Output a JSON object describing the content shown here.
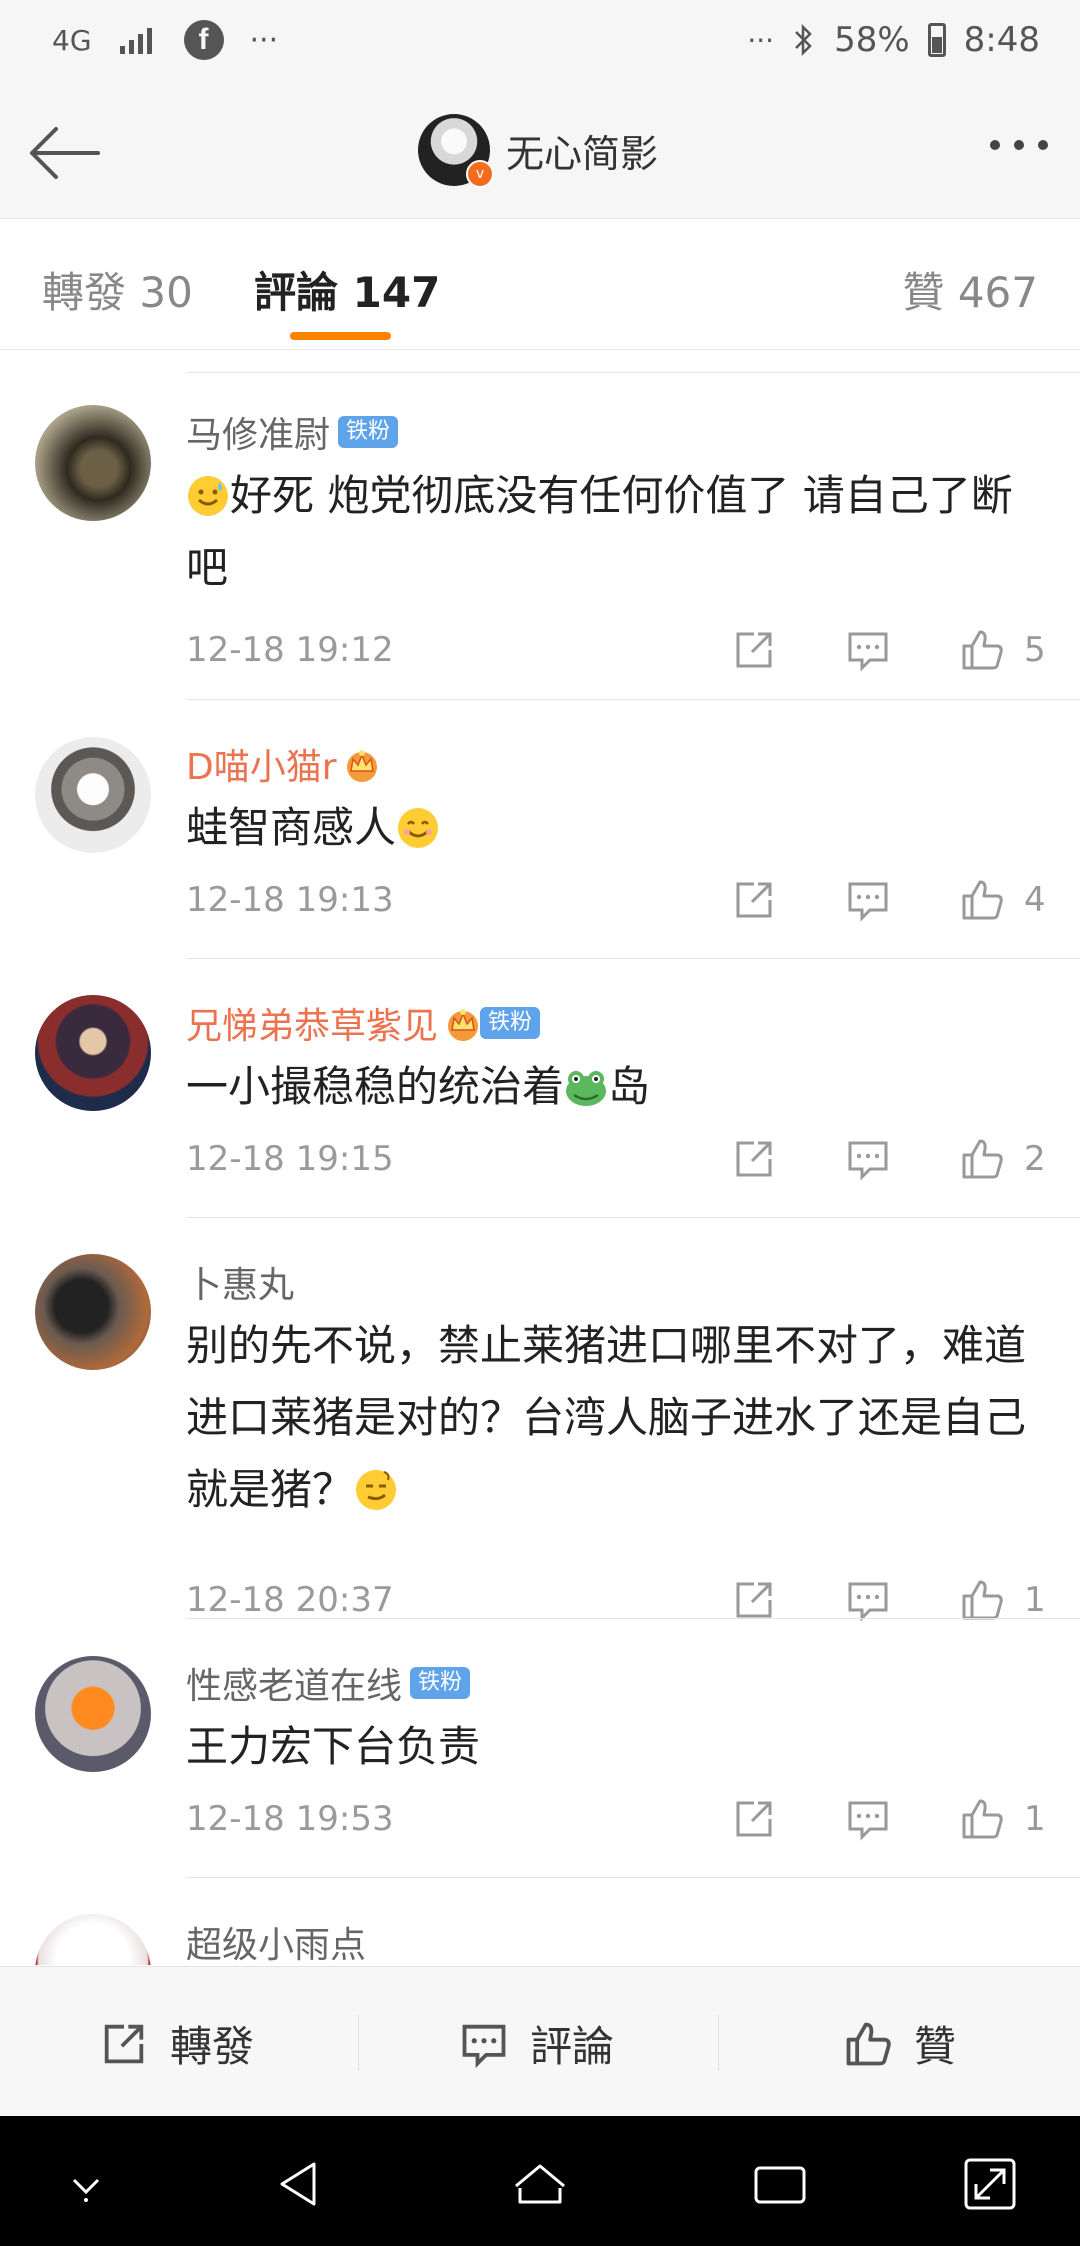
{
  "status_bar": {
    "network": "4G",
    "signal_icon": "signal-icon",
    "app_icon": "facebook-icon",
    "left_more": "···",
    "right_more": "···",
    "bluetooth_icon": "bluetooth-icon",
    "battery": "58%",
    "time": "8:48"
  },
  "header": {
    "back_icon": "back-arrow-icon",
    "user_name": "无心简影",
    "more_icon": "more-dots-icon"
  },
  "tabs": {
    "repost": "轉發 30",
    "comments": "評論 147",
    "likes": "贊 467"
  },
  "comments": [
    {
      "user": "马修准尉",
      "badge": "铁粉",
      "crown": false,
      "text_emoji": "smile-sweat-emoji",
      "text": "好死 炮党彻底没有任何价值了 请自己了断吧",
      "time": "12-18 19:12",
      "likes": "5"
    },
    {
      "user": "D喵小猫r",
      "badge": "",
      "crown": true,
      "text": "蛙智商感人",
      "time": "12-18 19:13",
      "likes": "4"
    },
    {
      "user": "兄悌弟恭草紫见",
      "badge": "铁粉",
      "crown": true,
      "text_part1": "一小撮稳稳的统治着",
      "text_part2": "岛",
      "time": "12-18 19:15",
      "likes": "2"
    },
    {
      "user": "卜惠丸",
      "badge": "",
      "crown": false,
      "text": "别的先不说，禁止莱猪进口哪里不对了，难道进口莱猪是对的？台湾人脑子进水了还是自己就是猪？",
      "time": "12-18 20:37",
      "likes": "1"
    },
    {
      "user": "性感老道在线",
      "badge": "铁粉",
      "crown": false,
      "text": "王力宏下台负责",
      "time": "12-18 19:53",
      "likes": "1"
    },
    {
      "user": "超级小雨点",
      "badge": "",
      "crown": false,
      "text": "",
      "time": "",
      "likes": ""
    }
  ],
  "bottom_bar": {
    "repost": "轉發",
    "comment": "評論",
    "like": "贊"
  },
  "colors": {
    "accent": "#ff8200",
    "vip_name": "#eb7350",
    "fan_badge": "#5fa3ea",
    "verified": "#f56c1e"
  }
}
